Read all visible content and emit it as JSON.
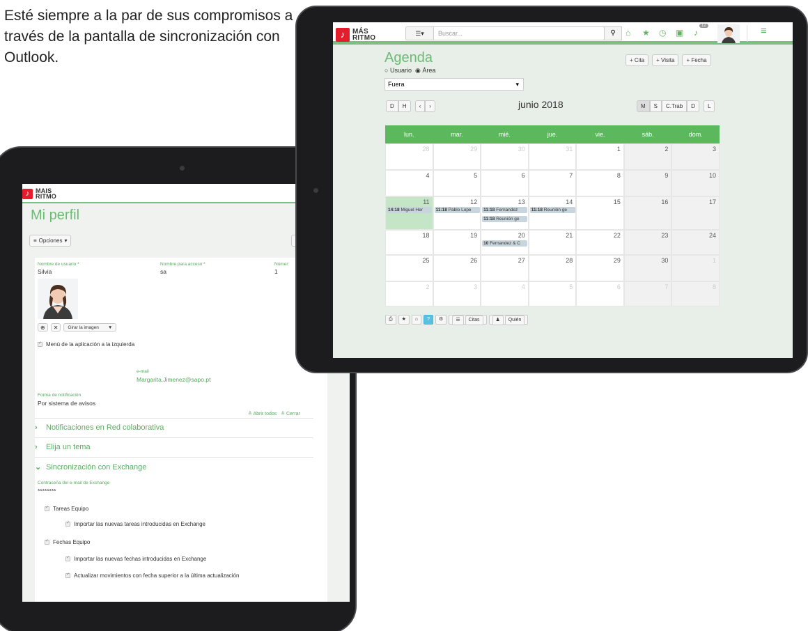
{
  "intro_text": "Esté siempre a la par de sus compromisos a través de la pantalla de sincronización con Outlook.",
  "brand": {
    "mark": "♪",
    "line1": "MÁS",
    "line2": "RITMO",
    "line1_alt": "MAIS",
    "color": "#e31d2b",
    "accent": "#5cb85c"
  },
  "profile": {
    "title": "Mi perfil",
    "options_button": "Opciones",
    "username_label": "Nombre de usuario *",
    "username_value": "Silvia",
    "access_label": "Nombre para acceso *",
    "access_value": "sa",
    "number_label": "Númer",
    "number_value": "1",
    "rotate_label": "Girar la imagen",
    "menu_left_label": "Menú de la aplicación a la izquierda",
    "email_label": "e-mail",
    "email_value": "Margarita.Jimenez@sapo.pt",
    "notif_label": "Forma de notificación",
    "notif_value": "Por sistema de avisos",
    "open_all": "Abrir todos",
    "close": "Cerrar",
    "sections": [
      "Notificaciones en Red colaborativa",
      "Elija un tema",
      "Sincronización con Exchange"
    ],
    "exchange_pw_label": "Contraseña del e-mail de Exchange",
    "exchange_pw_value": "********",
    "tareas": "Tareas Equipo",
    "tareas_import": "Importar las nuevas tareas introducidas en Exchange",
    "fechas": "Fechas Equipo",
    "fechas_import": "Importar las nuevas fechas introducidas en Exchange",
    "fechas_update": "Actualizar movimientos con fecha superior a la última actualización"
  },
  "agenda": {
    "search_placeholder": "Buscar...",
    "notif_count": "12",
    "title": "Agenda",
    "btn_cita": "+ Cita",
    "btn_visita": "+ Visita",
    "btn_fecha": "+ Fecha",
    "radio_usuario": "Usuario",
    "radio_area": "Área",
    "select_value": "Fuera",
    "month": "junio 2018",
    "view_d": "D",
    "view_h": "H",
    "view_m": "M",
    "view_s": "S",
    "view_ctrab": "C.Trab",
    "view_d2": "D",
    "view_l": "L",
    "days": [
      "lun.",
      "mar.",
      "mié.",
      "jue.",
      "vie.",
      "sáb.",
      "dom."
    ],
    "weeks": [
      [
        "28",
        "29",
        "30",
        "31",
        "1",
        "2",
        "3"
      ],
      [
        "4",
        "5",
        "6",
        "7",
        "8",
        "9",
        "10"
      ],
      [
        "11",
        "12",
        "13",
        "14",
        "15",
        "16",
        "17"
      ],
      [
        "18",
        "19",
        "20",
        "21",
        "22",
        "23",
        "24"
      ],
      [
        "25",
        "26",
        "27",
        "28",
        "29",
        "30",
        "1"
      ],
      [
        "2",
        "3",
        "4",
        "5",
        "6",
        "7",
        "8"
      ]
    ],
    "events": [
      {
        "time": "14:18",
        "text": "Miguel Her"
      },
      {
        "time": "11:18",
        "text": "Pablo Lope"
      },
      {
        "time": "11:18",
        "text": "Fernandez"
      },
      {
        "time": "11:18",
        "text": "Reunión ge"
      },
      {
        "time": "11:18",
        "text": "Reunión ge"
      },
      {
        "time": "10",
        "text": "Fernandez & C"
      }
    ],
    "bottom_citas": "Citas",
    "bottom_quien": "Quién"
  }
}
